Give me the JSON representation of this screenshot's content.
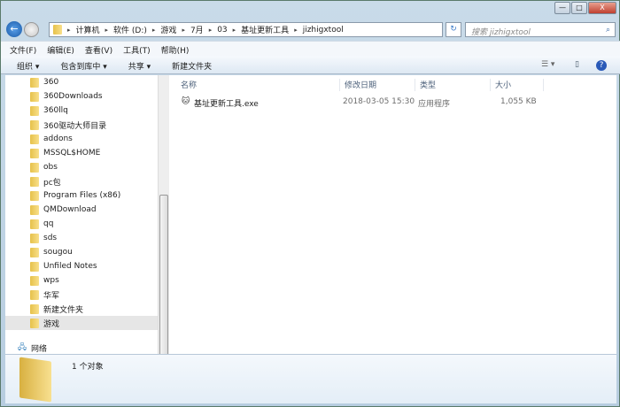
{
  "window": {
    "min": "—",
    "max": "□",
    "close": "X"
  },
  "address": {
    "crumbs": [
      "计算机",
      "软件 (D:)",
      "游戏",
      "7月",
      "03",
      "基址更新工具",
      "jizhigxtool"
    ],
    "search_placeholder": "搜索 jizhigxtool"
  },
  "menu": [
    "文件(F)",
    "编辑(E)",
    "查看(V)",
    "工具(T)",
    "帮助(H)"
  ],
  "toolbar": [
    "组织 ▾",
    "包含到库中 ▾",
    "共享 ▾",
    "新建文件夹"
  ],
  "nav": {
    "items": [
      "360",
      "360Downloads",
      "360llq",
      "360驱动大师目录",
      "addons",
      "MSSQL$HOME",
      "obs",
      "pc包",
      "Program Files (x86)",
      "QMDownload",
      "qq",
      "sds",
      "sougou",
      "Unfiled Notes",
      "wps",
      "华军",
      "新建文件夹",
      "游戏"
    ],
    "selected": "游戏",
    "network": "网络"
  },
  "columns": [
    "名称",
    "修改日期",
    "类型",
    "大小"
  ],
  "files": [
    {
      "name": "基址更新工具.exe",
      "date": "2018-03-05 15:30",
      "type": "应用程序",
      "size": "1,055 KB"
    }
  ],
  "details": {
    "count": "1 个对象"
  }
}
